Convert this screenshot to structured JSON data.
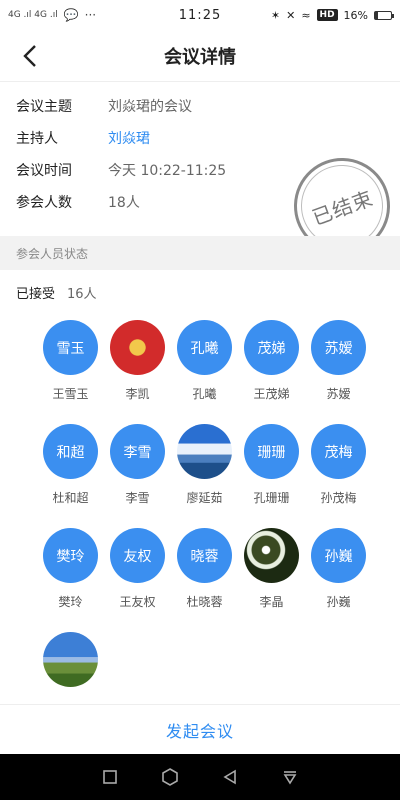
{
  "status_bar": {
    "left": "4G .ıl  4G .ıl",
    "chat_icon": "chat-bubble-icon",
    "more": "···",
    "time": "11:25",
    "hd": "HD",
    "battery": "16%",
    "battery_level": 0.16
  },
  "header": {
    "title": "会议详情"
  },
  "info": {
    "topic_label": "会议主题",
    "topic_value": "刘焱珺的会议",
    "host_label": "主持人",
    "host_value": "刘焱珺",
    "time_label": "会议时间",
    "time_value": "今天 10:22-11:25",
    "count_label": "参会人数",
    "count_value": "18人"
  },
  "stamp": {
    "text": "已结束"
  },
  "section": {
    "title": "参会人员状态"
  },
  "accepted": {
    "label": "已接受",
    "count": "16人"
  },
  "participants": [
    {
      "avatar": "雪玉",
      "name": "王雪玉"
    },
    {
      "avatar": "",
      "name": "李凯",
      "image": "fu-character"
    },
    {
      "avatar": "孔曦",
      "name": "孔曦"
    },
    {
      "avatar": "茂娣",
      "name": "王茂娣"
    },
    {
      "avatar": "苏嫒",
      "name": "苏嫒"
    },
    {
      "avatar": "和超",
      "name": "杜和超"
    },
    {
      "avatar": "李雪",
      "name": "李雪"
    },
    {
      "avatar": "",
      "name": "廖延茹",
      "image": "lake"
    },
    {
      "avatar": "珊珊",
      "name": "孔珊珊"
    },
    {
      "avatar": "茂梅",
      "name": "孙茂梅"
    },
    {
      "avatar": "樊玲",
      "name": "樊玲"
    },
    {
      "avatar": "友权",
      "name": "王友权"
    },
    {
      "avatar": "晓蓉",
      "name": "杜晓蓉"
    },
    {
      "avatar": "",
      "name": "李晶",
      "image": "flower"
    },
    {
      "avatar": "孙巍",
      "name": "孙巍"
    },
    {
      "avatar": "",
      "name": "",
      "image": "field"
    }
  ],
  "bottom": {
    "start_label": "发起会议"
  },
  "colors": {
    "accent": "#2f8cf1",
    "avatar_bg": "#3b8ff0"
  }
}
